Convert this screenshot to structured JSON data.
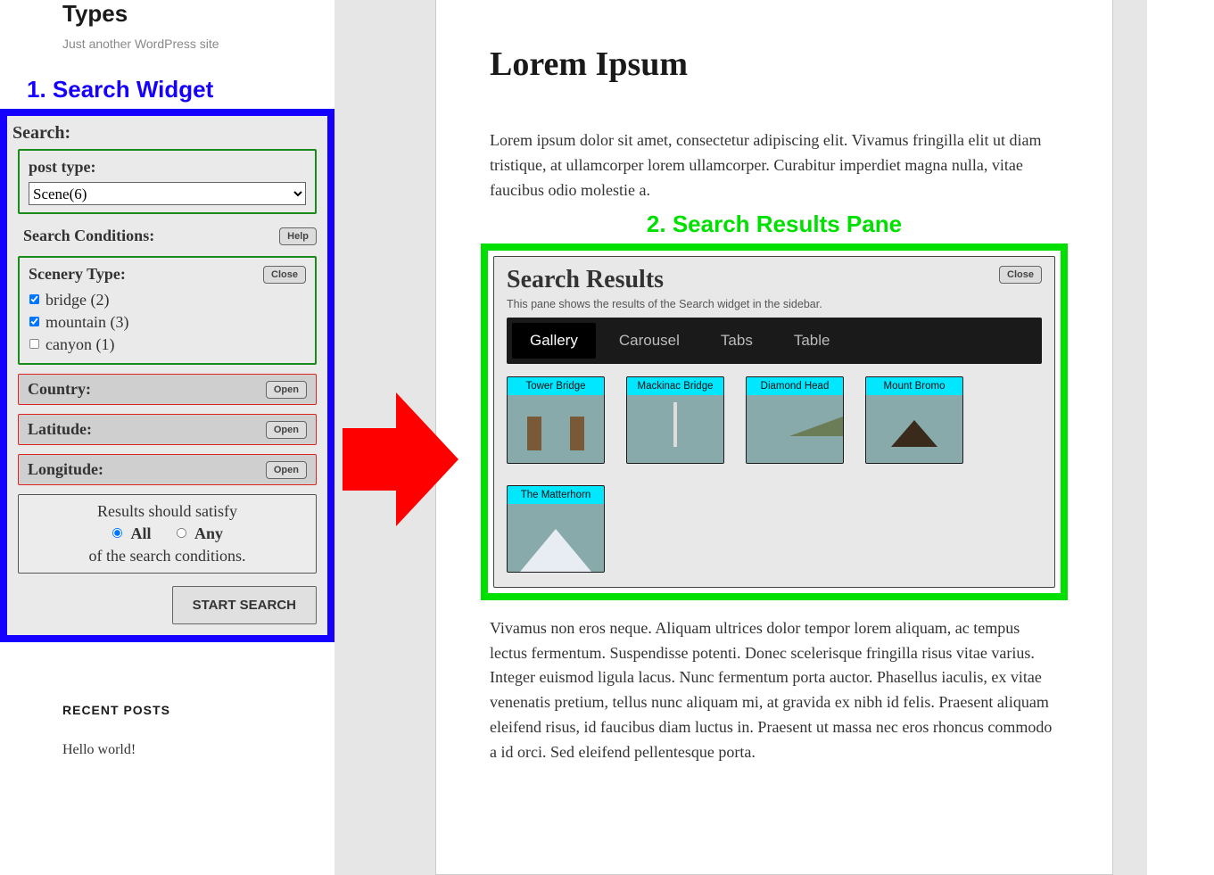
{
  "site": {
    "title": "Types",
    "tagline": "Just another WordPress site"
  },
  "annotations": {
    "widget": "1. Search Widget",
    "results": "2. Search Results Pane"
  },
  "widget": {
    "header": "Search:",
    "post_type_label": "post type:",
    "post_type_selected": "Scene(6)",
    "conditions_label": "Search Conditions:",
    "help_btn": "Help",
    "scenery": {
      "title": "Scenery Type:",
      "close_btn": "Close",
      "items": [
        {
          "label": "bridge (2)",
          "checked": true
        },
        {
          "label": "mountain (3)",
          "checked": true
        },
        {
          "label": "canyon (1)",
          "checked": false
        }
      ]
    },
    "closed": {
      "country": {
        "title": "Country:",
        "btn": "Open"
      },
      "latitude": {
        "title": "Latitude:",
        "btn": "Open"
      },
      "longitude": {
        "title": "Longitude:",
        "btn": "Open"
      }
    },
    "satisfy": {
      "line1": "Results should satisfy",
      "all": "All",
      "any": "Any",
      "line2": "of the search conditions."
    },
    "start_btn": "START SEARCH"
  },
  "recent": {
    "title": "RECENT POSTS",
    "post1": "Hello world!"
  },
  "article": {
    "title": "Lorem Ipsum",
    "p1": "Lorem ipsum dolor sit amet, consectetur adipiscing elit. Vivamus fringilla elit ut diam tristique, at ullamcorper lorem ullamcorper. Curabitur imperdiet magna nulla, vitae faucibus odio molestie a.",
    "p2": "Vivamus non eros neque. Aliquam ultrices dolor tempor lorem aliquam, ac tempus lectus fermentum. Suspendisse potenti. Donec scelerisque fringilla risus vitae varius. Integer euismod ligula lacus. Nunc fermentum porta auctor. Phasellus iaculis, ex vitae venenatis pretium, tellus nunc aliquam mi, at gravida ex nibh id felis. Praesent aliquam eleifend risus, id faucibus diam luctus in. Praesent ut massa nec eros rhoncus commodo a id orci. Sed eleifend pellentesque porta."
  },
  "results": {
    "title": "Search Results",
    "close_btn": "Close",
    "subtitle": "This pane shows the results of the Search widget in the sidebar.",
    "tabs": [
      "Gallery",
      "Carousel",
      "Tabs",
      "Table"
    ],
    "active_tab": "Gallery",
    "items": [
      {
        "caption": "Tower Bridge",
        "thumb": "tb-tower"
      },
      {
        "caption": "Mackinac Bridge",
        "thumb": "tb-mackinac"
      },
      {
        "caption": "Diamond Head",
        "thumb": "tb-diamond"
      },
      {
        "caption": "Mount Bromo",
        "thumb": "tb-bromo"
      },
      {
        "caption": "The Matterhorn",
        "thumb": "tb-matterhorn"
      }
    ]
  }
}
